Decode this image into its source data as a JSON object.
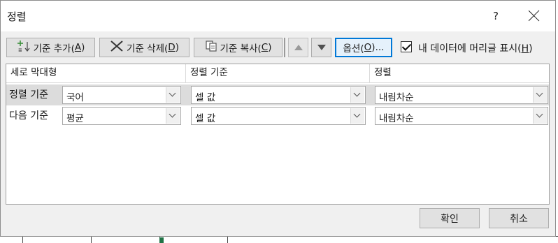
{
  "dialog": {
    "title": "정렬",
    "help_label": "?"
  },
  "toolbar": {
    "add_level": "기준 추가(",
    "add_level_key": "A",
    "delete_level": "기준 삭제(",
    "delete_level_key": "D",
    "copy_level": "기준 복사(",
    "copy_level_key": "C",
    "options": "옵션(",
    "options_key": "O",
    "options_suffix": ")...",
    "close_paren": ")",
    "move_up_icon": "triangle-up-icon",
    "move_down_icon": "triangle-down-icon"
  },
  "header_option": {
    "checked": true,
    "label": "내 데이터에 머리글 표시(",
    "key": "H",
    "close_paren": ")"
  },
  "columns": {
    "column": "세로 막대형",
    "sort_on": "정렬 기준",
    "order": "정렬"
  },
  "levels": [
    {
      "label": "정렬 기준",
      "column": "국어",
      "sort_on": "셀 값",
      "order": "내림차순",
      "selected": true
    },
    {
      "label": "다음 기준",
      "column": "평균",
      "sort_on": "셀 값",
      "order": "내림차순",
      "selected": false
    }
  ],
  "footer": {
    "ok": "확인",
    "cancel": "취소"
  }
}
